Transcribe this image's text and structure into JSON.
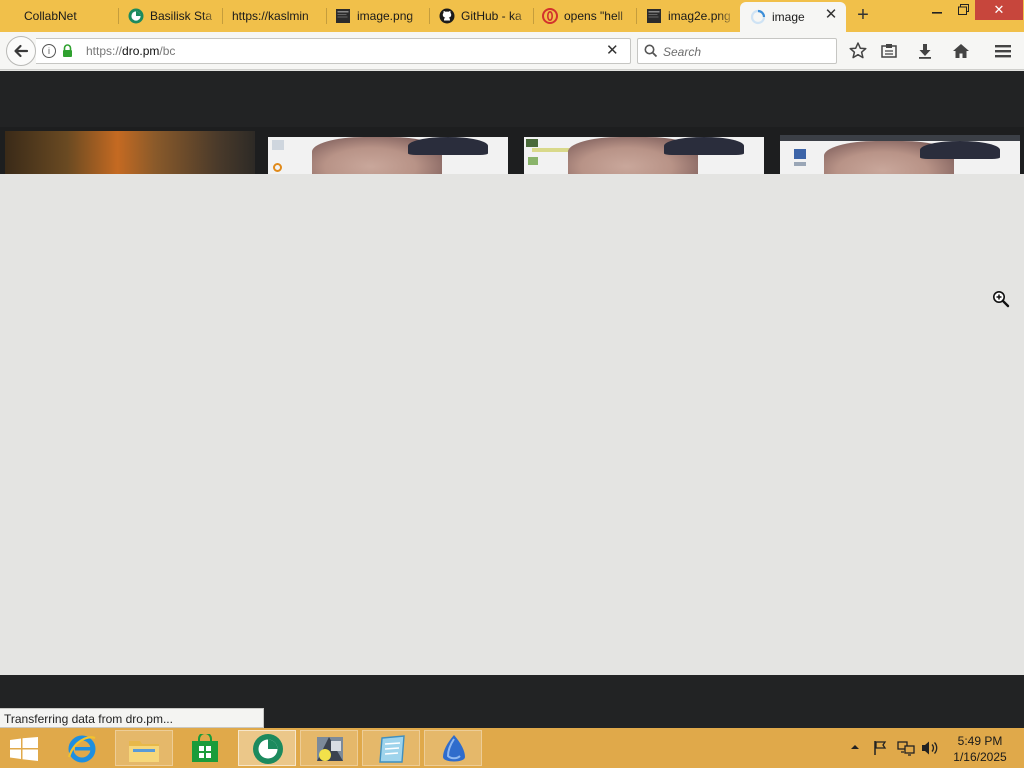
{
  "tabs": [
    {
      "label": "CollabNet",
      "icon": "none"
    },
    {
      "label": "Basilisk Sta",
      "icon": "basilisk-icon"
    },
    {
      "label": "https://kaslmin",
      "icon": "none"
    },
    {
      "label": "image.png",
      "icon": "image-file-icon"
    },
    {
      "label": "GitHub - ka",
      "icon": "github-icon"
    },
    {
      "label": "opens \"hell",
      "icon": "opera-icon"
    },
    {
      "label": "imag2e.png",
      "icon": "image-file-icon"
    },
    {
      "label": "image",
      "icon": "loading-spinner-icon"
    }
  ],
  "nav": {
    "url_prefix": "https://",
    "url_domain": "dro.pm",
    "url_path": "/bc",
    "search_placeholder": "Search"
  },
  "status": {
    "text": "Transferring data from dro.pm..."
  },
  "clock": {
    "time": "5:49 PM",
    "date": "1/16/2025"
  },
  "colors": {
    "tab_strip": "#f1c04a",
    "taskbar": "#e0a94a",
    "page_dark": "#222324",
    "loading_bg": "#e4e4e2"
  }
}
